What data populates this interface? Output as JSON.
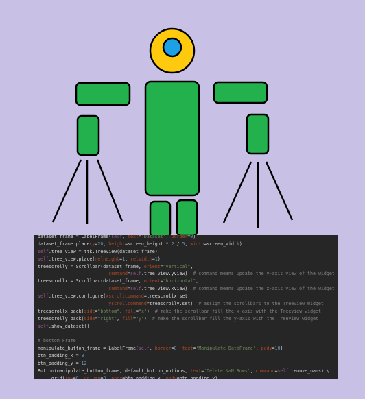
{
  "colors": {
    "background": "#c9c0e6",
    "head_yellow": "#ffc90e",
    "eye_blue": "#1ea0e6",
    "body_green": "#22b14c",
    "outline": "#000000",
    "code_bg": "#262626"
  },
  "icons": [
    "robot-figure",
    "tripod-left",
    "tripod-right"
  ],
  "code": {
    "lines": [
      [
        {
          "t": "dataset_frame = LabelFrame("
        },
        {
          "t": "self",
          "c": "self"
        },
        {
          "t": ", "
        },
        {
          "t": "text",
          "c": "param"
        },
        {
          "t": "="
        },
        {
          "t": "'Dataset'",
          "c": "str"
        },
        {
          "t": ", "
        },
        {
          "t": "border",
          "c": "param"
        },
        {
          "t": "="
        },
        {
          "t": "0",
          "c": "num"
        },
        {
          "t": ")"
        }
      ],
      [
        {
          "t": "dataset_frame.place("
        },
        {
          "t": "y",
          "c": "param"
        },
        {
          "t": "="
        },
        {
          "t": "20",
          "c": "num"
        },
        {
          "t": ", "
        },
        {
          "t": "height",
          "c": "param"
        },
        {
          "t": "=screen_height * "
        },
        {
          "t": "2",
          "c": "num"
        },
        {
          "t": " / "
        },
        {
          "t": "5",
          "c": "num"
        },
        {
          "t": ", "
        },
        {
          "t": "width",
          "c": "param"
        },
        {
          "t": "=screen_width)"
        }
      ],
      [
        {
          "t": "self",
          "c": "self"
        },
        {
          "t": ".tree_view = ttk.Treeview(dataset_frame)"
        }
      ],
      [
        {
          "t": "self",
          "c": "self"
        },
        {
          "t": ".tree_view.place("
        },
        {
          "t": "relheight",
          "c": "param"
        },
        {
          "t": "="
        },
        {
          "t": "1",
          "c": "num"
        },
        {
          "t": ", "
        },
        {
          "t": "relwidth",
          "c": "param"
        },
        {
          "t": "="
        },
        {
          "t": "1",
          "c": "num"
        },
        {
          "t": ")"
        }
      ],
      [
        {
          "t": "treescrolly = Scrollbar(dataset_frame, "
        },
        {
          "t": "orient",
          "c": "param"
        },
        {
          "t": "="
        },
        {
          "t": "\"vertical\"",
          "c": "str"
        },
        {
          "t": ","
        }
      ],
      [
        {
          "t": "                          "
        },
        {
          "t": "command",
          "c": "param"
        },
        {
          "t": "="
        },
        {
          "t": "self",
          "c": "self"
        },
        {
          "t": ".tree_view.yview)  "
        },
        {
          "t": "# command means update the y-axis view of the widget",
          "c": "com"
        }
      ],
      [
        {
          "t": "treescrollx = Scrollbar(dataset_frame, "
        },
        {
          "t": "orient",
          "c": "param"
        },
        {
          "t": "="
        },
        {
          "t": "\"horizontal\"",
          "c": "str"
        },
        {
          "t": ","
        }
      ],
      [
        {
          "t": "                          "
        },
        {
          "t": "command",
          "c": "param"
        },
        {
          "t": "="
        },
        {
          "t": "self",
          "c": "self"
        },
        {
          "t": ".tree_view.xview)  "
        },
        {
          "t": "# command means update the x-axis view of the widget",
          "c": "com"
        }
      ],
      [
        {
          "t": "self",
          "c": "self"
        },
        {
          "t": ".tree_view.configure("
        },
        {
          "t": "xscrollcommand",
          "c": "param"
        },
        {
          "t": "=treescrollx.set,"
        }
      ],
      [
        {
          "t": "                          "
        },
        {
          "t": "yscrollcommand",
          "c": "param"
        },
        {
          "t": "=treescrolly.set)  "
        },
        {
          "t": "# assign the scrollbars to the Treeview Widget",
          "c": "com"
        }
      ],
      [
        {
          "t": "treescrollx.pack("
        },
        {
          "t": "side",
          "c": "param"
        },
        {
          "t": "="
        },
        {
          "t": "\"bottom\"",
          "c": "str"
        },
        {
          "t": ", "
        },
        {
          "t": "fill",
          "c": "param"
        },
        {
          "t": "="
        },
        {
          "t": "\"x\"",
          "c": "str"
        },
        {
          "t": ")  "
        },
        {
          "t": "# make the scrollbar fill the x-axis with the Treeview widget",
          "c": "com"
        }
      ],
      [
        {
          "t": "treescrolly.pack("
        },
        {
          "t": "side",
          "c": "param"
        },
        {
          "t": "="
        },
        {
          "t": "\"right\"",
          "c": "str"
        },
        {
          "t": ", "
        },
        {
          "t": "fill",
          "c": "param"
        },
        {
          "t": "="
        },
        {
          "t": "\"y\"",
          "c": "str"
        },
        {
          "t": ")  "
        },
        {
          "t": "# make the scrollbar fill the y-axis with the Treeview widget",
          "c": "com"
        }
      ],
      [
        {
          "t": "self",
          "c": "self"
        },
        {
          "t": ".show_dataset()"
        }
      ],
      [
        {
          "t": ""
        }
      ],
      [
        {
          "t": "# bottom Frame",
          "c": "com"
        }
      ],
      [
        {
          "t": "manipulate_button_frame = LabelFrame("
        },
        {
          "t": "self",
          "c": "self"
        },
        {
          "t": ", "
        },
        {
          "t": "border",
          "c": "param"
        },
        {
          "t": "="
        },
        {
          "t": "0",
          "c": "num"
        },
        {
          "t": ", "
        },
        {
          "t": "text",
          "c": "param"
        },
        {
          "t": "="
        },
        {
          "t": "'Manipulate DataFrame'",
          "c": "str"
        },
        {
          "t": ", "
        },
        {
          "t": "pady",
          "c": "param"
        },
        {
          "t": "="
        },
        {
          "t": "10",
          "c": "num"
        },
        {
          "t": ")"
        }
      ],
      [
        {
          "t": "btn_padding_x = "
        },
        {
          "t": "8",
          "c": "num"
        }
      ],
      [
        {
          "t": "btn_padding_y = "
        },
        {
          "t": "12",
          "c": "num"
        }
      ],
      [
        {
          "t": "Button(manipulate_button_frame, default_button_options, "
        },
        {
          "t": "text",
          "c": "param"
        },
        {
          "t": "="
        },
        {
          "t": "'Delete NaN Rows'",
          "c": "str"
        },
        {
          "t": ", "
        },
        {
          "t": "command",
          "c": "param"
        },
        {
          "t": "="
        },
        {
          "t": "self",
          "c": "self"
        },
        {
          "t": ".remove_nans) \\"
        }
      ],
      [
        {
          "t": "    .grid("
        },
        {
          "t": "row",
          "c": "param"
        },
        {
          "t": "="
        },
        {
          "t": "0",
          "c": "num"
        },
        {
          "t": ", "
        },
        {
          "t": "column",
          "c": "param"
        },
        {
          "t": "="
        },
        {
          "t": "0",
          "c": "num"
        },
        {
          "t": ", "
        },
        {
          "t": "padx",
          "c": "param"
        },
        {
          "t": "=btn_padding_x, "
        },
        {
          "t": "pady",
          "c": "param"
        },
        {
          "t": "=btn_padding_y)"
        }
      ]
    ]
  }
}
